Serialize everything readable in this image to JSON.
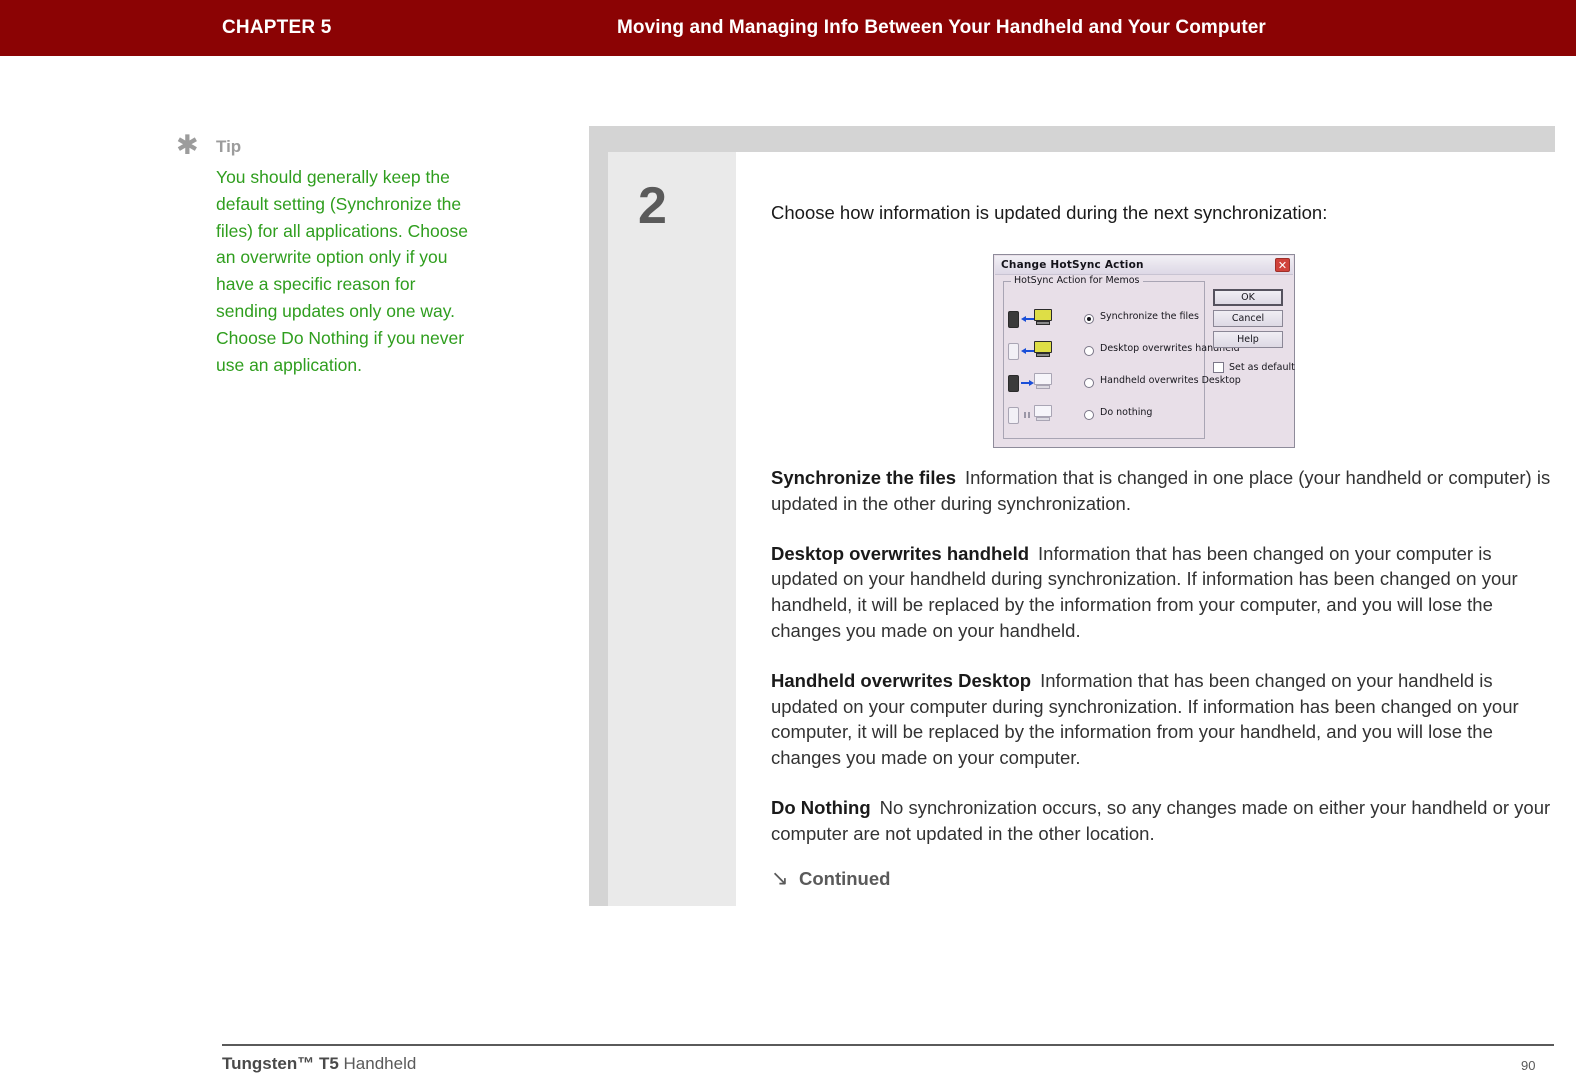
{
  "header": {
    "chapter": "CHAPTER 5",
    "title": "Moving and Managing Info Between Your Handheld and Your Computer",
    "bar_color": "#8B0304"
  },
  "tip": {
    "icon": "asterisk-icon",
    "label": "Tip",
    "body": "You should generally keep the default setting (Synchronize the files) for all applications. Choose an overwrite option only if you have a specific reason for sending updates only one way. Choose Do Nothing if you never use an application.",
    "text_color": "#2F9E1E",
    "label_color": "#9c9c9c"
  },
  "step": {
    "number": "2",
    "intro": "Choose how information is updated during the next synchronization:"
  },
  "dialog": {
    "title": "Change HotSync Action",
    "close_icon": "close-icon",
    "close_glyph": "✕",
    "groupbox_label": "HotSync Action for Memos",
    "options": [
      {
        "label": "Synchronize the files",
        "selected": true,
        "icon": "handheld-two-way-sync-icon"
      },
      {
        "label": "Desktop overwrites handheld",
        "selected": false,
        "icon": "desktop-to-handheld-icon"
      },
      {
        "label": "Handheld overwrites Desktop",
        "selected": false,
        "icon": "handheld-to-desktop-icon"
      },
      {
        "label": "Do nothing",
        "selected": false,
        "icon": "no-sync-icon"
      }
    ],
    "buttons": [
      {
        "label": "OK",
        "default": true
      },
      {
        "label": "Cancel",
        "default": false
      },
      {
        "label": "Help",
        "default": false
      }
    ],
    "checkbox": {
      "label": "Set as default",
      "checked": false
    }
  },
  "definitions": [
    {
      "term": "Synchronize the files",
      "description": "Information that is changed in one place (your handheld or computer) is updated in the other during synchronization."
    },
    {
      "term": "Desktop overwrites handheld",
      "description": "Information that has been changed on your computer is updated on your handheld during synchronization. If information has been changed on your handheld, it will be replaced by the information from your computer, and you will lose the changes you made on your handheld."
    },
    {
      "term": "Handheld overwrites Desktop",
      "description": "Information that has been changed on your handheld is updated on your computer during synchronization. If information has been changed on your computer, it will be replaced by the information from your handheld, and you will lose the changes you made on your computer."
    },
    {
      "term": "Do Nothing",
      "description": "No synchronization occurs, so any changes made on either your handheld or your computer are not updated in the other location."
    }
  ],
  "continued": {
    "arrow_icon": "arrow-down-right-icon",
    "arrow_glyph": "↘",
    "label": "Continued"
  },
  "footer": {
    "product_bold": "Tungsten™ T5",
    "product_rest": " Handheld",
    "page_number": "90"
  }
}
